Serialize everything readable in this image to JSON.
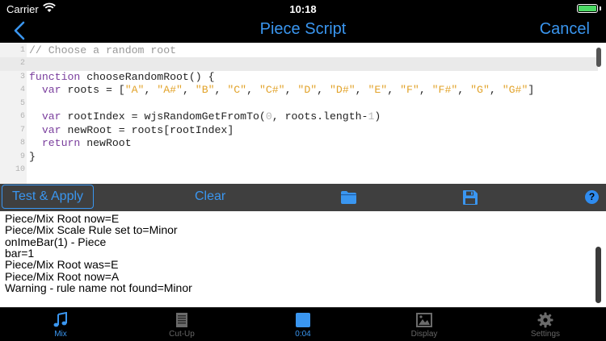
{
  "status_bar": {
    "carrier": "Carrier",
    "time": "10:18",
    "battery_color": "#4cd964"
  },
  "nav": {
    "title": "Piece Script",
    "cancel_label": "Cancel"
  },
  "editor": {
    "lines": [
      {
        "num": "1",
        "segments": [
          {
            "t": "// Choose a random root",
            "c": "comment"
          }
        ]
      },
      {
        "num": "2",
        "segments": []
      },
      {
        "num": "3",
        "segments": [
          {
            "t": "function",
            "c": "kw"
          },
          {
            "t": " chooseRandomRoot() {",
            "c": ""
          }
        ]
      },
      {
        "num": "4",
        "segments": [
          {
            "t": "  ",
            "c": ""
          },
          {
            "t": "var",
            "c": "kw"
          },
          {
            "t": " roots = [",
            "c": ""
          },
          {
            "t": "\"A\"",
            "c": "str"
          },
          {
            "t": ", ",
            "c": ""
          },
          {
            "t": "\"A#\"",
            "c": "str"
          },
          {
            "t": ", ",
            "c": ""
          },
          {
            "t": "\"B\"",
            "c": "str"
          },
          {
            "t": ", ",
            "c": ""
          },
          {
            "t": "\"C\"",
            "c": "str"
          },
          {
            "t": ", ",
            "c": ""
          },
          {
            "t": "\"C#\"",
            "c": "str"
          },
          {
            "t": ", ",
            "c": ""
          },
          {
            "t": "\"D\"",
            "c": "str"
          },
          {
            "t": ", ",
            "c": ""
          },
          {
            "t": "\"D#\"",
            "c": "str"
          },
          {
            "t": ", ",
            "c": ""
          },
          {
            "t": "\"E\"",
            "c": "str"
          },
          {
            "t": ", ",
            "c": ""
          },
          {
            "t": "\"F\"",
            "c": "str"
          },
          {
            "t": ", ",
            "c": ""
          },
          {
            "t": "\"F#\"",
            "c": "str"
          },
          {
            "t": ", ",
            "c": ""
          },
          {
            "t": "\"G\"",
            "c": "str"
          },
          {
            "t": ", ",
            "c": ""
          },
          {
            "t": "\"G#\"",
            "c": "str"
          },
          {
            "t": "]",
            "c": ""
          }
        ]
      },
      {
        "num": "5",
        "segments": []
      },
      {
        "num": "6",
        "segments": [
          {
            "t": "  ",
            "c": ""
          },
          {
            "t": "var",
            "c": "kw"
          },
          {
            "t": " rootIndex = wjsRandomGetFromTo(",
            "c": ""
          },
          {
            "t": "0",
            "c": "num"
          },
          {
            "t": ", roots.length-",
            "c": ""
          },
          {
            "t": "1",
            "c": "num"
          },
          {
            "t": ")",
            "c": ""
          }
        ]
      },
      {
        "num": "7",
        "segments": [
          {
            "t": "  ",
            "c": ""
          },
          {
            "t": "var",
            "c": "kw"
          },
          {
            "t": " newRoot = roots[rootIndex]",
            "c": ""
          }
        ]
      },
      {
        "num": "8",
        "segments": [
          {
            "t": "  ",
            "c": ""
          },
          {
            "t": "return",
            "c": "kw"
          },
          {
            "t": " newRoot",
            "c": ""
          }
        ]
      },
      {
        "num": "9",
        "segments": [
          {
            "t": "}",
            "c": ""
          }
        ]
      },
      {
        "num": "10",
        "segments": []
      }
    ]
  },
  "toolbar": {
    "test_apply_label": "Test & Apply",
    "clear_label": "Clear",
    "help_label": "?"
  },
  "console": {
    "lines": [
      "Piece/Mix Root now=E",
      "Piece/Mix Scale Rule set to=Minor",
      "onImeBar(1) - Piece",
      "bar=1",
      "Piece/Mix Root was=E",
      "Piece/Mix Root now=A",
      "Warning - rule name not found=Minor"
    ]
  },
  "tabs": [
    {
      "label": "Mix",
      "icon": "music-note-icon",
      "active": true
    },
    {
      "label": "Cut-Up",
      "icon": "document-icon",
      "active": false
    },
    {
      "label": "0:04",
      "icon": "stop-square-icon",
      "active": true
    },
    {
      "label": "Display",
      "icon": "image-icon",
      "active": false
    },
    {
      "label": "Settings",
      "icon": "gear-icon",
      "active": false
    }
  ],
  "colors": {
    "accent": "#3a96f0",
    "toolbar": "#3f3f3f",
    "keyword": "#7a3e9d",
    "string": "#e2a32a"
  }
}
